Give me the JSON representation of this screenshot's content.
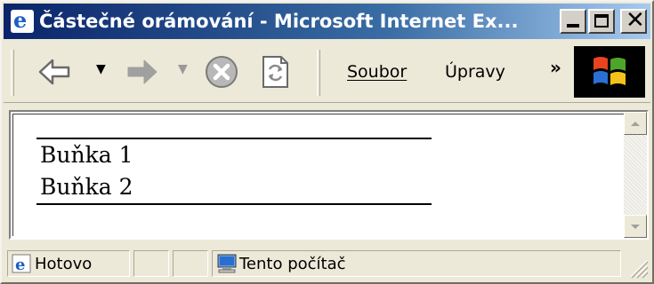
{
  "window": {
    "title": "Částečné orámování - Microsoft Internet Ex...",
    "title_buttons": [
      "minimize",
      "maximize",
      "close"
    ]
  },
  "toolbar": {
    "back_icon": "back-arrow-icon",
    "forward_icon": "forward-arrow-icon",
    "stop_icon": "stop-icon",
    "refresh_icon": "refresh-icon",
    "menu": {
      "file": "Soubor",
      "edit": "Úpravy"
    },
    "more": "»"
  },
  "content": {
    "cells": [
      "Buňka 1",
      "Buňka 2"
    ]
  },
  "status": {
    "text": "Hotovo",
    "zone": "Tento počítač"
  }
}
